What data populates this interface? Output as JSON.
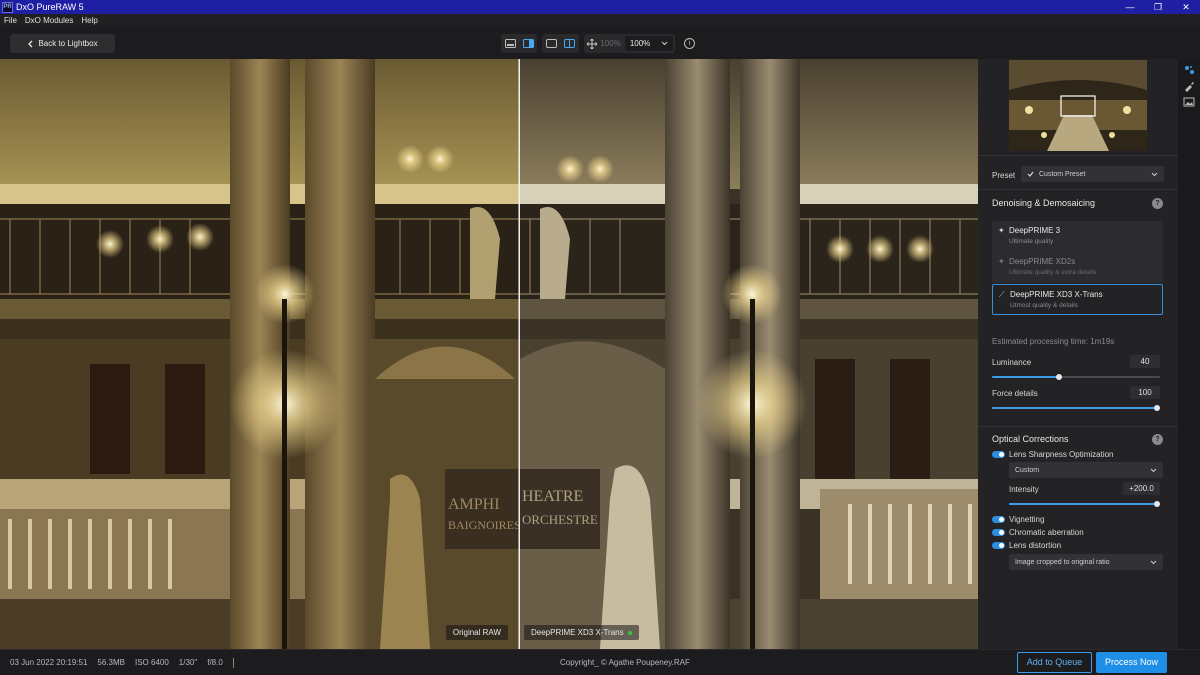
{
  "window": {
    "logo_text": "PR",
    "title": "DxO PureRAW 5",
    "minimize": "—",
    "restore": "❐",
    "close": "✕"
  },
  "menu": [
    "File",
    "DxO Modules",
    "Help"
  ],
  "toolbar": {
    "back_label": "Back to Lightbox",
    "zoom_fit": "100%",
    "zoom_value": "100%",
    "info": "i"
  },
  "viewer": {
    "left_label": "Original RAW",
    "right_label": "DeepPRIME XD3 X-Trans",
    "right_status_color": "#2ecc40"
  },
  "panel": {
    "preset_label": "Preset",
    "preset_value": "Custom Preset",
    "denoise": {
      "title": "Denoising & Demosaicing",
      "help": "?",
      "algorithms": [
        {
          "name": "DeepPRIME 3",
          "subtitle": "Ultimate quality",
          "state": "available"
        },
        {
          "name": "DeepPRIME XD2s",
          "subtitle": "Ultimate quality & extra details",
          "state": "disabled"
        },
        {
          "name": "DeepPRIME XD3 X-Trans",
          "subtitle": "Utmost quality & details",
          "state": "selected"
        }
      ],
      "estimate": "Estimated processing time:  1m19s",
      "luminance_label": "Luminance",
      "luminance_value": "40",
      "luminance_level": 40,
      "force_label": "Force details",
      "force_value": "100",
      "force_level": 100
    },
    "optical": {
      "title": "Optical Corrections",
      "help": "?",
      "lens_sharpness": "Lens Sharpness Optimization",
      "lens_mode": "Custom",
      "intensity_label": "Intensity",
      "intensity_value": "+200.0",
      "intensity_level": 100,
      "vignetting": "Vignetting",
      "chromatic": "Chromatic aberration",
      "distortion": "Lens distortion",
      "crop_mode": "Image cropped to original ratio"
    }
  },
  "status": {
    "date": "03 Jun 2022 20:19:51",
    "size": "56.3MB",
    "iso": "ISO 6400",
    "shutter": "1/30\"",
    "aperture": "f/8.0",
    "filename": "Copyright_ © Agathe Poupeney.RAF"
  },
  "actions": {
    "queue": "Add to Queue",
    "process": "Process Now"
  },
  "colors": {
    "accent": "#1f8ee6",
    "titlebar": "#1f1fa3"
  }
}
